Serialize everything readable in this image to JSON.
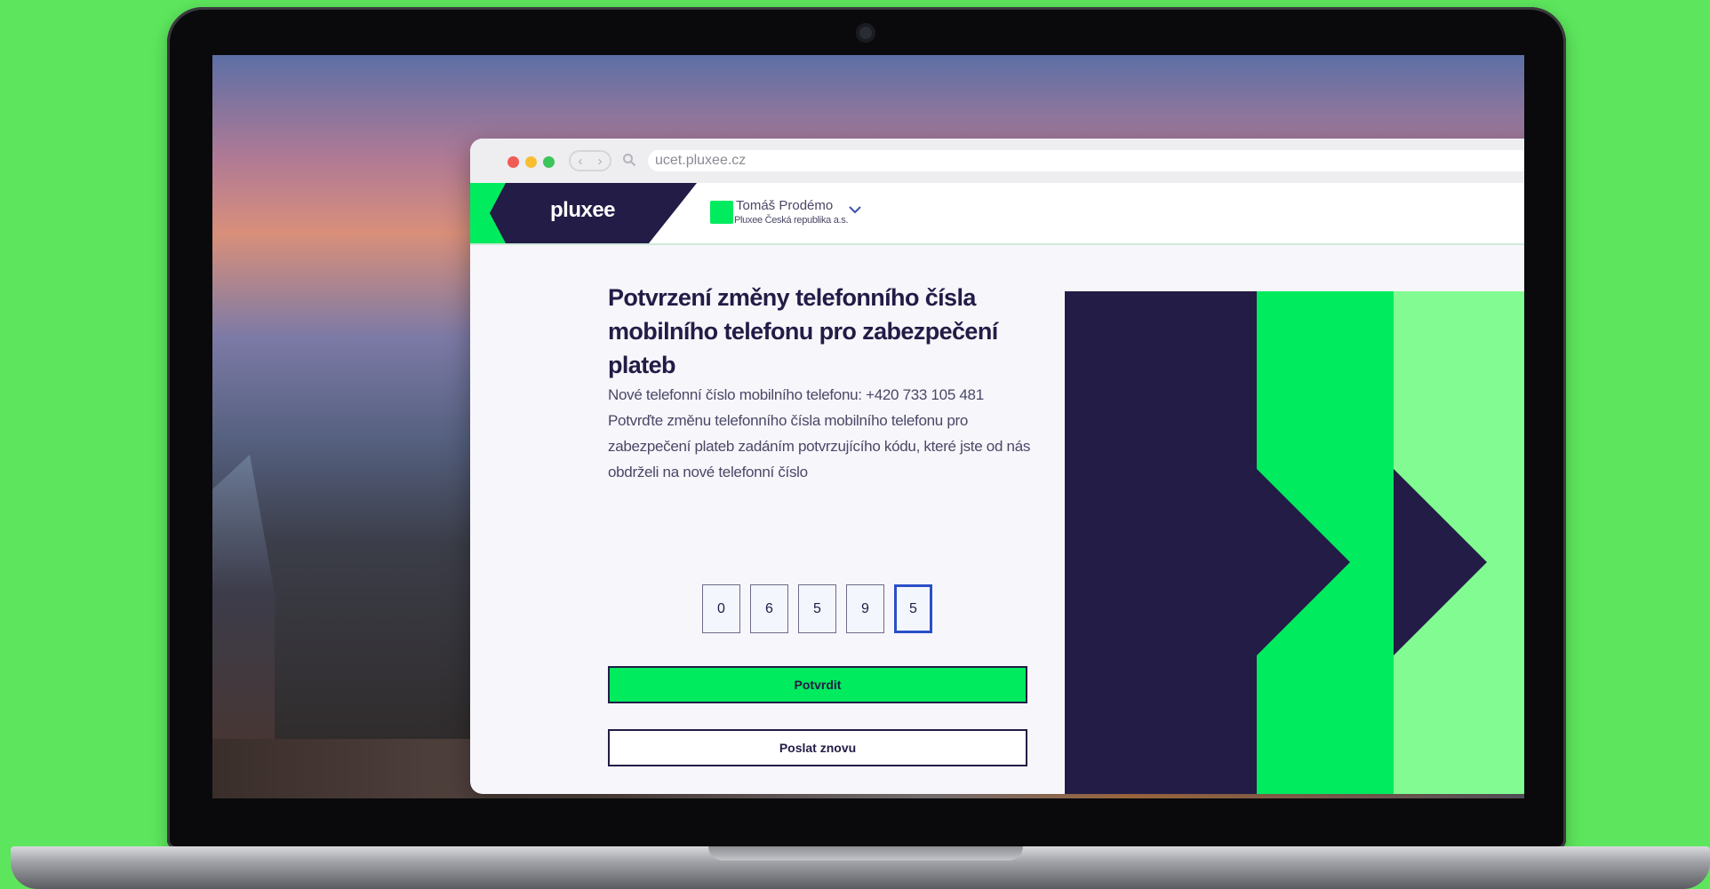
{
  "browser": {
    "url": "ucet.pluxee.cz"
  },
  "header": {
    "logo_text": "pluxee",
    "user_name": "Tomáš Prodémo",
    "user_company": "Pluxee Česká republika a.s."
  },
  "main": {
    "title": "Potvrzení změny telefonního čísla mobilního telefonu pro zabezpečení plateb",
    "phone_line": "Nové telefonní číslo mobilního telefonu: +420 733 105 481",
    "instructions": "Potvrďte změnu telefonního čísla mobilního telefonu pro zabezpečení plateb zadáním potvrzujícího kódu, které jste od nás obdrželi na nové telefonní číslo",
    "code_digits": [
      "0",
      "6",
      "5",
      "9",
      "5"
    ],
    "confirm_label": "Potvrdit",
    "resend_label": "Poslat znovu"
  },
  "icons": {
    "chat": "chat-bubble-icon",
    "chevron": "chevron-down-icon",
    "search": "search-icon",
    "menu": "hamburger-icon"
  },
  "colors": {
    "brand_green": "#00eb5e",
    "brand_light_green": "#82fb92",
    "brand_dark": "#221c46",
    "background_green": "#5de65d"
  }
}
